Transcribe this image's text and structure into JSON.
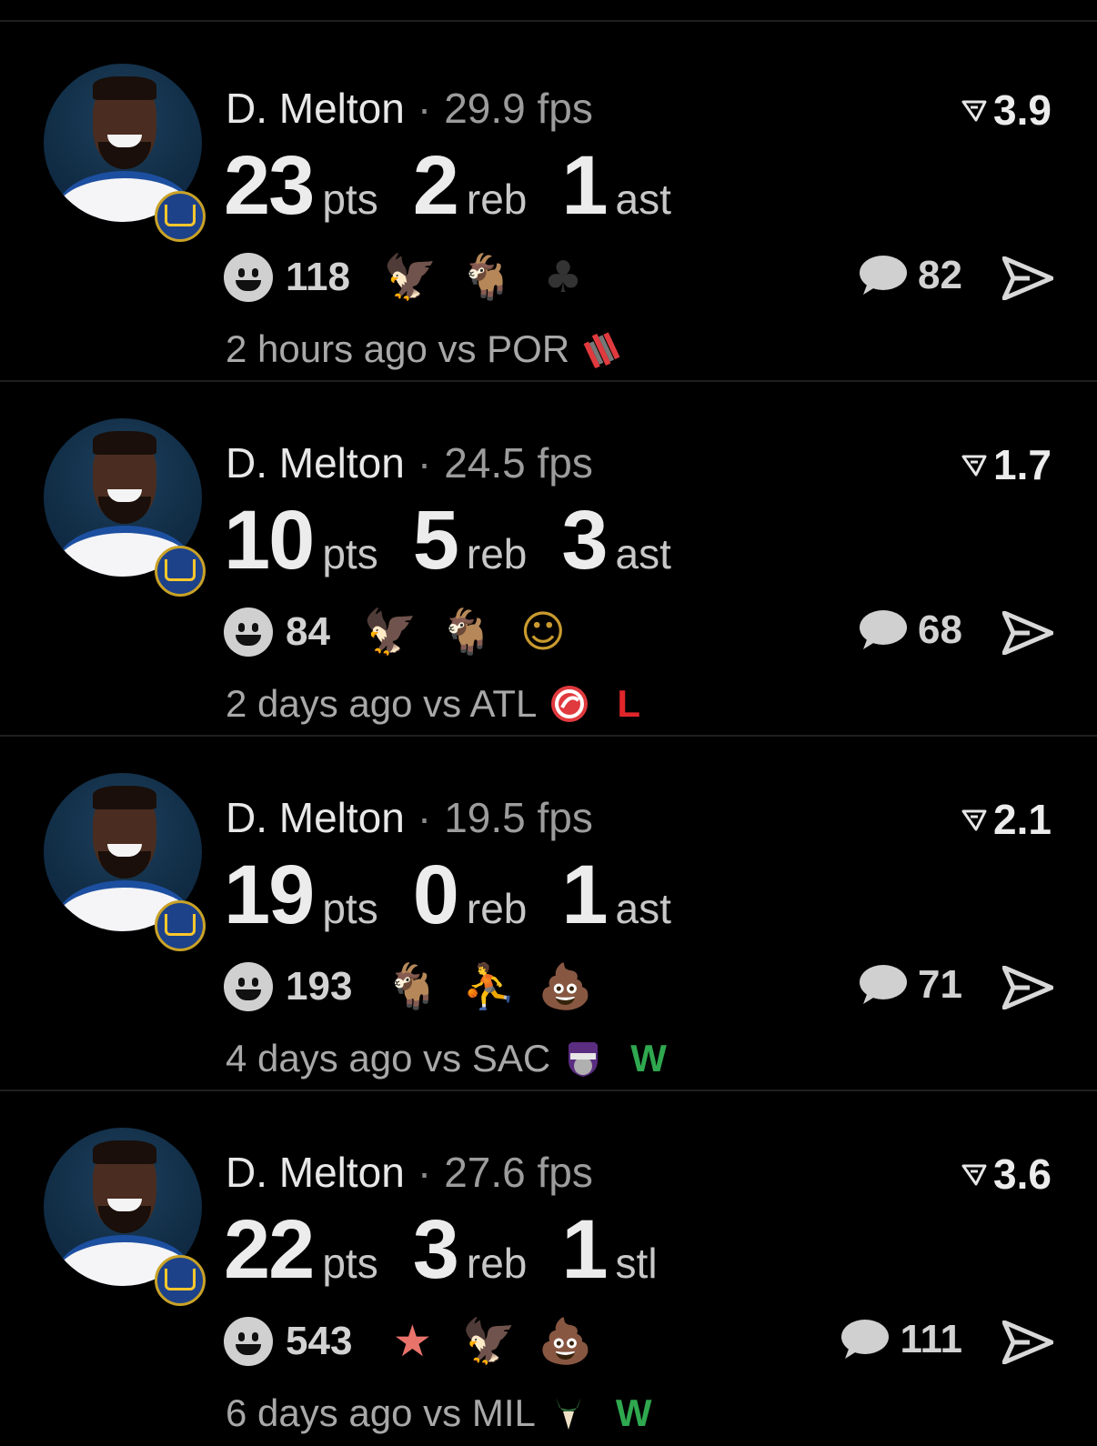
{
  "feed": [
    {
      "player": "D. Melton",
      "fps": "29.9 fps",
      "rating": "3.9",
      "stats": [
        {
          "value": "23",
          "unit": "pts"
        },
        {
          "value": "2",
          "unit": "reb"
        },
        {
          "value": "1",
          "unit": "ast"
        }
      ],
      "reaction_count": "118",
      "reaction_emojis": [
        "eagle",
        "goat",
        "club"
      ],
      "comment_count": "82",
      "time_vs": "2 hours ago vs POR",
      "opponent_logo": "blazers-logo",
      "result": ""
    },
    {
      "player": "D. Melton",
      "fps": "24.5 fps",
      "rating": "1.7",
      "stats": [
        {
          "value": "10",
          "unit": "pts"
        },
        {
          "value": "5",
          "unit": "reb"
        },
        {
          "value": "3",
          "unit": "ast"
        }
      ],
      "reaction_count": "84",
      "reaction_emojis": [
        "eagle",
        "goat",
        "melting-face"
      ],
      "comment_count": "68",
      "time_vs": "2 days ago vs ATL",
      "opponent_logo": "hawks-logo",
      "result": "L"
    },
    {
      "player": "D. Melton",
      "fps": "19.5 fps",
      "rating": "2.1",
      "stats": [
        {
          "value": "19",
          "unit": "pts"
        },
        {
          "value": "0",
          "unit": "reb"
        },
        {
          "value": "1",
          "unit": "ast"
        }
      ],
      "reaction_count": "193",
      "reaction_emojis": [
        "goat",
        "player-sticker",
        "poop"
      ],
      "comment_count": "71",
      "time_vs": "4 days ago vs SAC",
      "opponent_logo": "kings-logo",
      "result": "W"
    },
    {
      "player": "D. Melton",
      "fps": "27.6 fps",
      "rating": "3.6",
      "stats": [
        {
          "value": "22",
          "unit": "pts"
        },
        {
          "value": "3",
          "unit": "reb"
        },
        {
          "value": "1",
          "unit": "stl"
        }
      ],
      "reaction_count": "543",
      "reaction_emojis": [
        "patrick-sticker",
        "eagle",
        "poop"
      ],
      "comment_count": "111",
      "time_vs": "6 days ago vs MIL",
      "opponent_logo": "bucks-logo",
      "result": "W"
    }
  ],
  "colors": {
    "background": "#000000",
    "loss": "#e0262a",
    "win": "#2fa84f",
    "warriors_blue": "#1d428a",
    "warriors_gold": "#ffc72c"
  }
}
